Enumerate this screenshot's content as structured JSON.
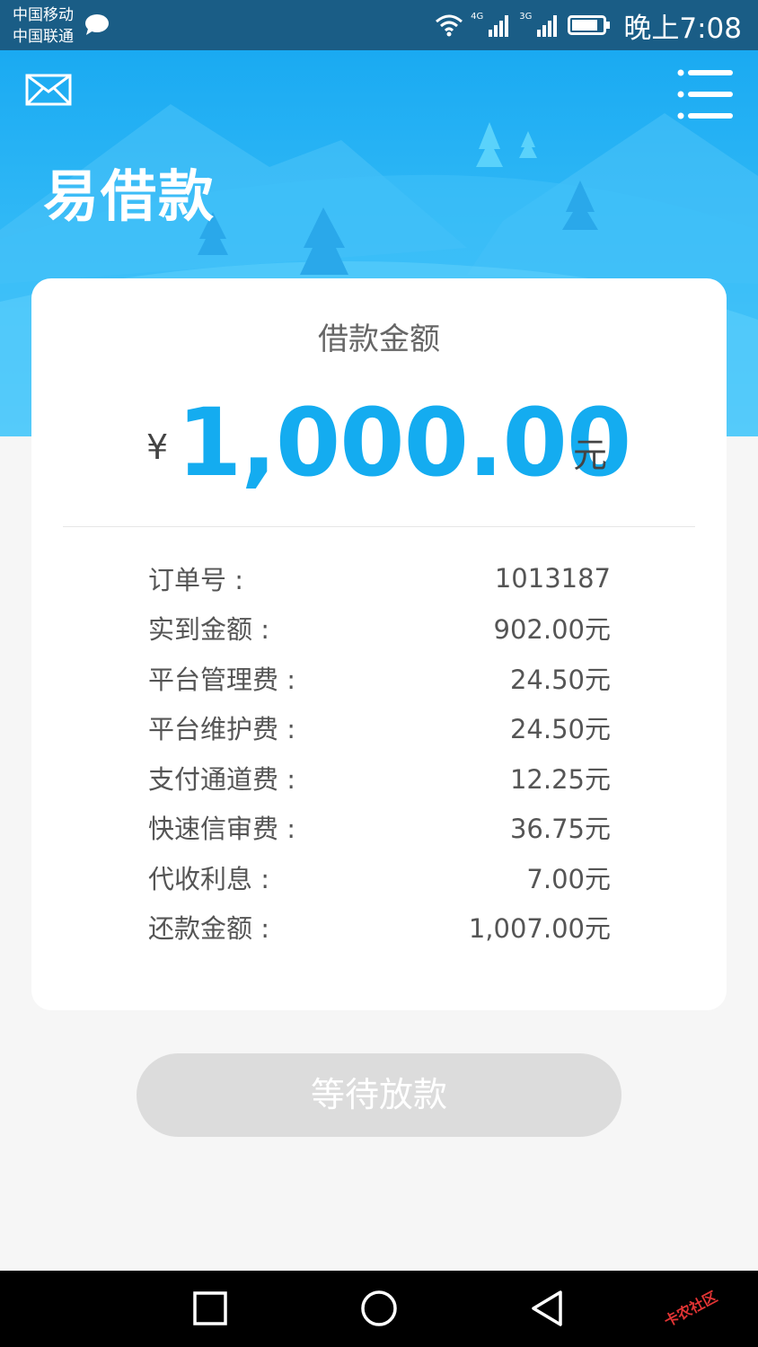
{
  "status_bar": {
    "carrier_1": "中国移动",
    "carrier_2": "中国联通",
    "signal_1_label": "4G",
    "signal_2_label": "3G",
    "time": "晚上7:08"
  },
  "header": {
    "app_title": "易借款"
  },
  "loan_card": {
    "label": "借款金额",
    "currency_symbol": "¥",
    "amount": "1,000.00",
    "unit": "元",
    "details": [
      {
        "label": "订单号 :",
        "value": "1013187"
      },
      {
        "label": "实到金额 :",
        "value": "902.00元"
      },
      {
        "label": "平台管理费 :",
        "value": "24.50元"
      },
      {
        "label": "平台维护费 :",
        "value": "24.50元"
      },
      {
        "label": "支付通道费 :",
        "value": "12.25元"
      },
      {
        "label": "快速信审费 :",
        "value": "36.75元"
      },
      {
        "label": "代收利息 :",
        "value": "7.00元"
      },
      {
        "label": "还款金额 :",
        "value": "1,007.00元"
      }
    ]
  },
  "action": {
    "button_label": "等待放款"
  },
  "watermark": {
    "text": "卡农社区"
  },
  "colors": {
    "accent": "#14acf0",
    "header_top": "#1aaaf2",
    "button_disabled": "#dcdcdc"
  },
  "icons": {
    "mail": "mail-icon",
    "menu": "menu-icon",
    "nav_back": "square-icon",
    "nav_home": "circle-icon",
    "nav_recent": "triangle-back-icon"
  }
}
